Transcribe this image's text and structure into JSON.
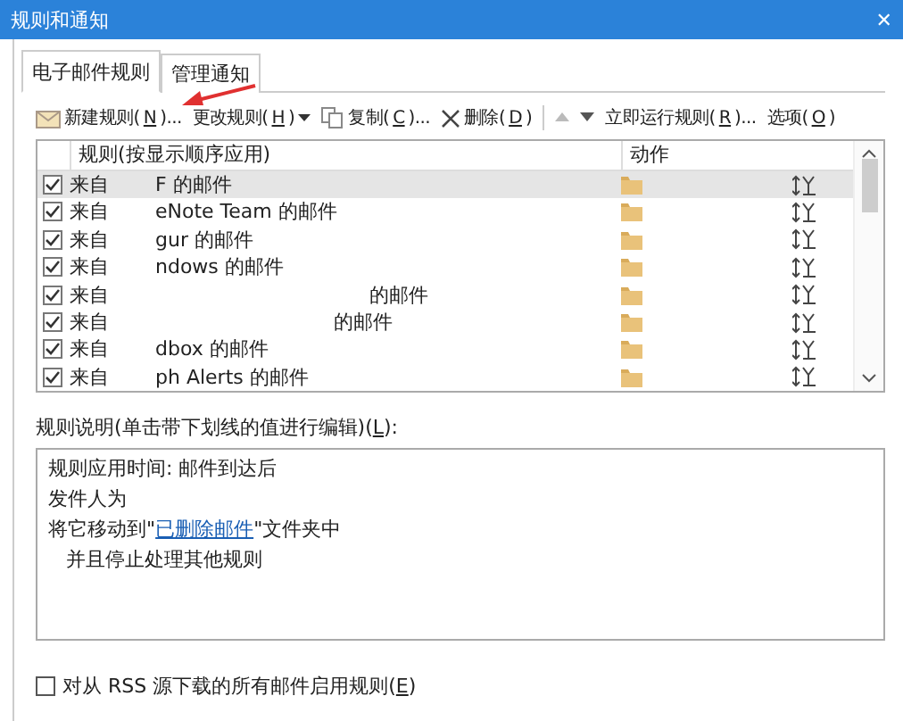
{
  "window": {
    "title": "规则和通知",
    "close": "✕"
  },
  "tabs": [
    {
      "label": "电子邮件规则",
      "selected": true
    },
    {
      "label": "管理通知",
      "selected": false
    }
  ],
  "toolbar": [
    {
      "kind": "new",
      "before": "新建规则(",
      "key": "N",
      "after": ")..."
    },
    {
      "kind": "menu",
      "before": "更改规则(",
      "key": "H",
      "after": ")"
    },
    {
      "kind": "copy",
      "before": "复制(",
      "key": "C",
      "after": ")..."
    },
    {
      "kind": "delete",
      "before": "删除(",
      "key": "D",
      "after": ")"
    },
    {
      "kind": "up",
      "disabled": true
    },
    {
      "kind": "down",
      "disabled": false
    },
    {
      "kind": "plain",
      "before": "立即运行规则(",
      "key": "R",
      "after": ")..."
    },
    {
      "kind": "plain",
      "before": "选项(",
      "key": "O",
      "after": ")"
    }
  ],
  "rules_table": {
    "columns": [
      "规则(按显示顺序应用)",
      "动作"
    ],
    "rows": [
      {
        "prefix": "来自",
        "rest": "F 的邮件",
        "checked": true,
        "selected": true
      },
      {
        "prefix": "来自",
        "rest": "eNote Team 的邮件",
        "checked": true,
        "selected": false
      },
      {
        "prefix": "来自",
        "rest": "gur 的邮件",
        "checked": true,
        "selected": false
      },
      {
        "prefix": "来自",
        "rest": "ndows 的邮件",
        "checked": true,
        "selected": false
      },
      {
        "prefix": "来自",
        "rest": "的邮件",
        "checked": true,
        "selected": false
      },
      {
        "prefix": "来自",
        "rest": "的邮件",
        "checked": true,
        "selected": false
      },
      {
        "prefix": "来自",
        "rest": "dbox 的邮件",
        "checked": true,
        "selected": false
      },
      {
        "prefix": "来自",
        "rest": "ph Alerts 的邮件",
        "checked": true,
        "selected": false
      }
    ]
  },
  "description": {
    "label_before": "规则说明(单击带下划线的值进行编辑)(",
    "label_key": "L",
    "label_after": "):",
    "lines": [
      {
        "kind": "text",
        "text": "规则应用时间: 邮件到达后"
      },
      {
        "kind": "text",
        "text": "发件人为"
      },
      {
        "kind": "link",
        "before": "将它移动到\"",
        "link": "已删除邮件",
        "after": "\"文件夹中"
      },
      {
        "kind": "indent",
        "text": "并且停止处理其他规则"
      }
    ]
  },
  "rss_option": {
    "before": "对从 RSS 源下载的所有邮件启用规则(",
    "key": "E",
    "after": ")",
    "checked": false
  }
}
